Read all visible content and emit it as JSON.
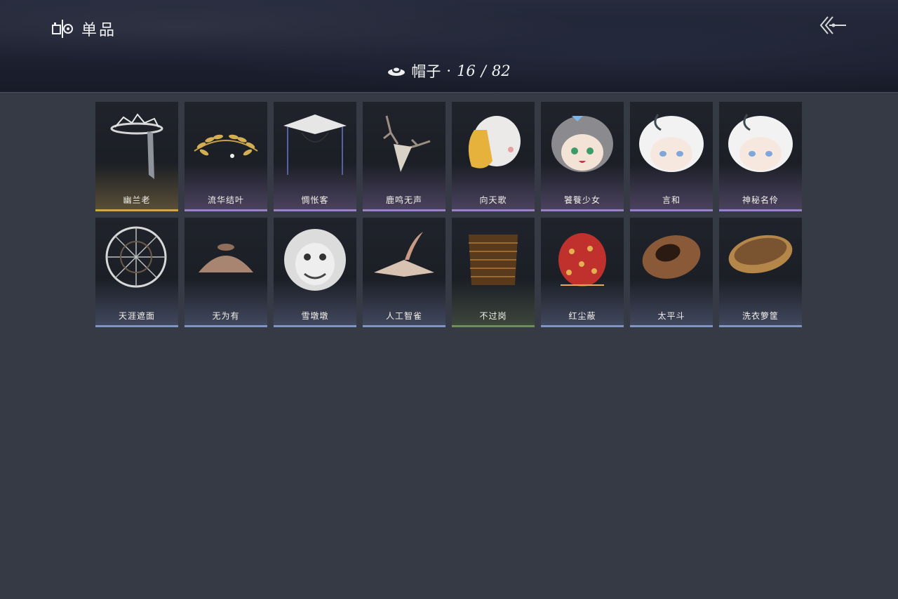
{
  "header": {
    "title": "单品",
    "category_name": "帽子",
    "category_separator": "·",
    "collected": "16",
    "total": "82",
    "back_icon": "double-chevron-left-icon"
  },
  "rarity_colors": {
    "gold": "#c9a94a",
    "purple": "#9b82c4",
    "blue": "#7f95c2",
    "green": "#6f8f5a"
  },
  "items": [
    {
      "name": "幽兰老",
      "rarity": "gold",
      "icon": "crown-veil-hat-icon"
    },
    {
      "name": "流华结叶",
      "rarity": "purple",
      "icon": "laurel-wreath-icon"
    },
    {
      "name": "惆怅客",
      "rarity": "purple",
      "icon": "veiled-hat-icon"
    },
    {
      "name": "鹿鸣无声",
      "rarity": "purple",
      "icon": "deer-skull-icon"
    },
    {
      "name": "向天歌",
      "rarity": "purple",
      "icon": "goose-hood-icon"
    },
    {
      "name": "饕餮少女",
      "rarity": "purple",
      "icon": "grey-hair-doll-head-icon"
    },
    {
      "name": "言和",
      "rarity": "purple",
      "icon": "white-hair-doll-head-icon"
    },
    {
      "name": "神秘名伶",
      "rarity": "purple",
      "icon": "white-hair-doll-head-icon"
    },
    {
      "name": "天涯遮面",
      "rarity": "blue",
      "icon": "wire-frame-hat-icon"
    },
    {
      "name": "无为有",
      "rarity": "blue",
      "icon": "clay-bowl-hat-icon"
    },
    {
      "name": "雪墩墩",
      "rarity": "blue",
      "icon": "white-lion-head-icon"
    },
    {
      "name": "人工智雀",
      "rarity": "blue",
      "icon": "bird-hat-icon"
    },
    {
      "name": "不过岗",
      "rarity": "green",
      "icon": "stacked-bowls-hat-icon"
    },
    {
      "name": "红尘蔽",
      "rarity": "blue",
      "icon": "red-hood-icon"
    },
    {
      "name": "太平斗",
      "rarity": "blue",
      "icon": "woven-basket-hat-icon"
    },
    {
      "name": "洗衣箩筐",
      "rarity": "blue",
      "icon": "laundry-basket-icon"
    }
  ]
}
